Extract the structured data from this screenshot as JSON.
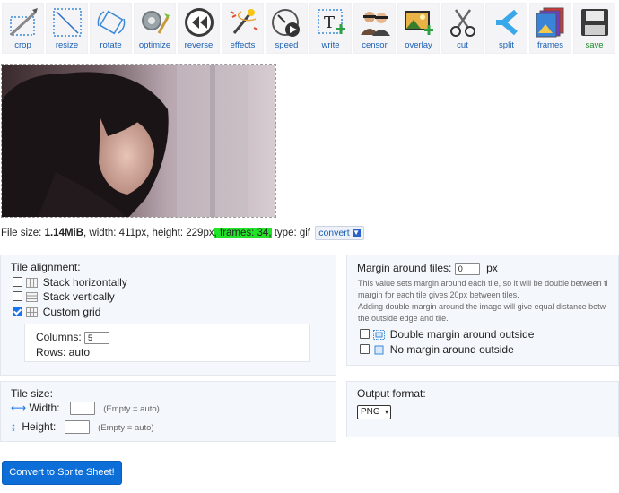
{
  "toolbar": {
    "tools": [
      {
        "label": "crop",
        "icon": "crop-icon"
      },
      {
        "label": "resize",
        "icon": "resize-icon"
      },
      {
        "label": "rotate",
        "icon": "rotate-icon"
      },
      {
        "label": "optimize",
        "icon": "optimize-icon"
      },
      {
        "label": "reverse",
        "icon": "reverse-icon"
      },
      {
        "label": "effects",
        "icon": "effects-icon"
      },
      {
        "label": "speed",
        "icon": "speed-icon"
      },
      {
        "label": "write",
        "icon": "write-icon"
      },
      {
        "label": "censor",
        "icon": "censor-icon"
      },
      {
        "label": "overlay",
        "icon": "overlay-icon"
      },
      {
        "label": "cut",
        "icon": "cut-icon"
      },
      {
        "label": "split",
        "icon": "split-icon"
      },
      {
        "label": "frames",
        "icon": "frames-icon"
      },
      {
        "label": "save",
        "icon": "save-icon"
      }
    ]
  },
  "file_info": {
    "size_label": "File size: ",
    "size_value": "1.14MiB",
    "width_text": ", width: 411px, height: 229px",
    "frames_text": ", frames: 34,",
    "type_text": " type: gif",
    "convert_label": "convert"
  },
  "tile_alignment": {
    "title": "Tile alignment:",
    "options": [
      {
        "label": "Stack horizontally",
        "checked": false
      },
      {
        "label": "Stack vertically",
        "checked": false
      },
      {
        "label": "Custom grid",
        "checked": true
      }
    ],
    "columns_label": "Columns:",
    "columns_value": "5",
    "rows_label": "Rows: auto"
  },
  "margin": {
    "title": "Margin around tiles:",
    "value": "0",
    "unit": "px",
    "note_lines": [
      "This value sets margin around each tile, so it will be double between ti",
      "margin for each tile gives 20px between tiles.",
      "Adding double margin around the image will give equal distance betw",
      "the outside edge and tile."
    ],
    "options": [
      {
        "label": "Double margin around outside",
        "checked": false
      },
      {
        "label": "No margin around outside",
        "checked": false
      }
    ]
  },
  "tile_size": {
    "title": "Tile size:",
    "width_label": "Width:",
    "height_label": "Height:",
    "hint": "(Empty = auto)"
  },
  "output_format": {
    "title": "Output format:",
    "selected": "PNG"
  },
  "submit_label": "Convert to Sprite Sheet!"
}
